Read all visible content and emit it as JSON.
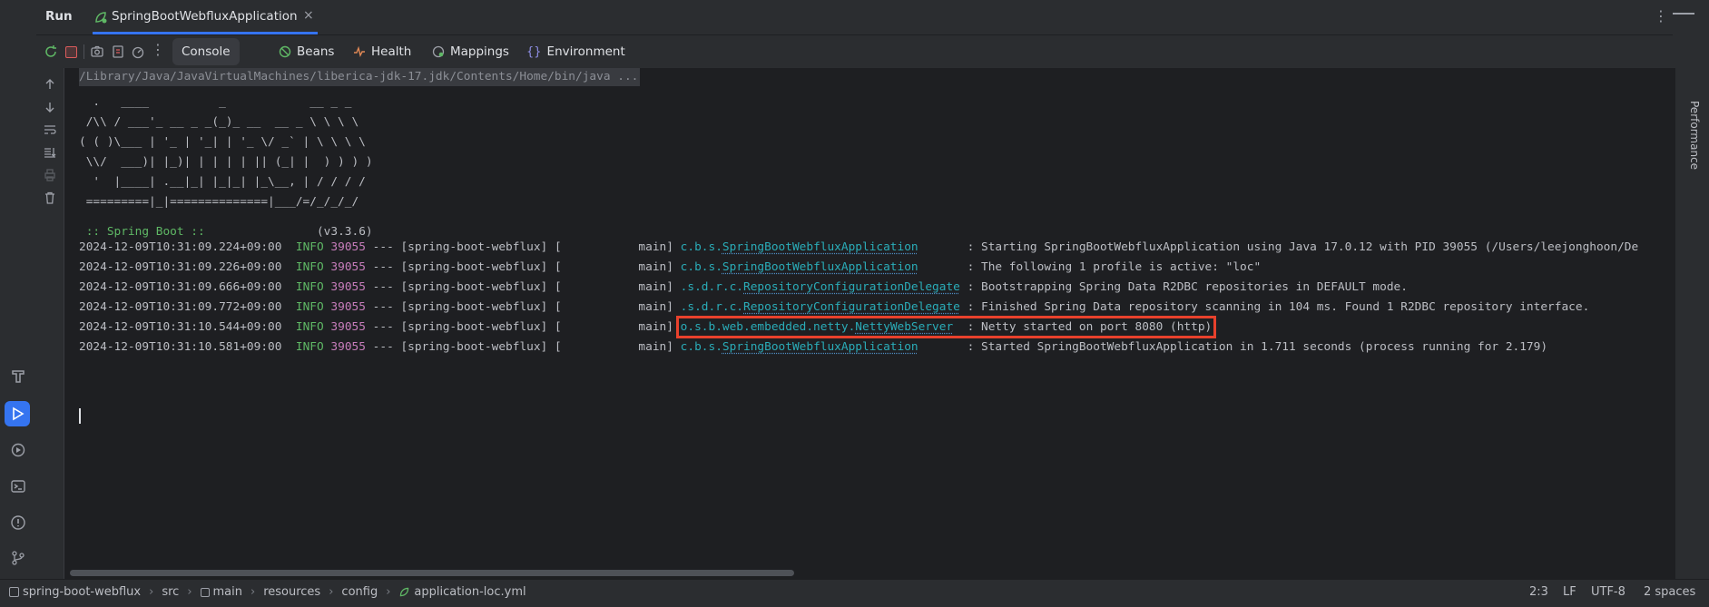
{
  "window": {
    "run_label": "Run",
    "tab_title": "SpringBootWebfluxApplication"
  },
  "toolbar": {
    "tabs": [
      {
        "label": "Console",
        "icon": "console"
      },
      {
        "label": "Beans",
        "icon": "beans-icon"
      },
      {
        "label": "Health",
        "icon": "health-icon"
      },
      {
        "label": "Mappings",
        "icon": "mappings-icon"
      },
      {
        "label": "Environment",
        "icon": "environment-icon"
      }
    ]
  },
  "console": {
    "command": "/Library/Java/JavaVirtualMachines/liberica-jdk-17.jdk/Contents/Home/bin/java ...",
    "banner": [
      "  .   ____          _            __ _ _",
      " /\\\\ / ___'_ __ _ _(_)_ __  __ _ \\ \\ \\ \\",
      "( ( )\\___ | '_ | '_| | '_ \\/ _` | \\ \\ \\ \\",
      " \\\\/  ___)| |_)| | | | | || (_| |  ) ) ) )",
      "  '  |____| .__|_| |_|_| |_\\__, | / / / /",
      " =========|_|==============|___/=/_/_/_/"
    ],
    "spring_boot_label": " :: Spring Boot ::",
    "spring_boot_version": "(v3.3.6)",
    "logs": [
      {
        "ts": "2024-12-09T10:31:09.224+09:00",
        "level": "INFO",
        "pid": "39055",
        "mid": "--- [spring-boot-webflux] [           main]",
        "pkg": "c.b.s.",
        "cls": "SpringBootWebfluxApplication",
        "pad": "       ",
        "msg": ": Starting SpringBootWebfluxApplication using Java 17.0.12 with PID 39055 (/Users/leejonghoon/De"
      },
      {
        "ts": "2024-12-09T10:31:09.226+09:00",
        "level": "INFO",
        "pid": "39055",
        "mid": "--- [spring-boot-webflux] [           main]",
        "pkg": "c.b.s.",
        "cls": "SpringBootWebfluxApplication",
        "pad": "       ",
        "msg": ": The following 1 profile is active: \"loc\""
      },
      {
        "ts": "2024-12-09T10:31:09.666+09:00",
        "level": "INFO",
        "pid": "39055",
        "mid": "--- [spring-boot-webflux] [           main]",
        "pkg": ".s.d.r.c.",
        "cls": "RepositoryConfigurationDelegate",
        "pad": " ",
        "msg": ": Bootstrapping Spring Data R2DBC repositories in DEFAULT mode."
      },
      {
        "ts": "2024-12-09T10:31:09.772+09:00",
        "level": "INFO",
        "pid": "39055",
        "mid": "--- [spring-boot-webflux] [           main]",
        "pkg": ".s.d.r.c.",
        "cls": "RepositoryConfigurationDelegate",
        "pad": " ",
        "msg": ": Finished Spring Data repository scanning in 104 ms. Found 1 R2DBC repository interface."
      },
      {
        "ts": "2024-12-09T10:31:10.544+09:00",
        "level": "INFO",
        "pid": "39055",
        "mid": "--- [spring-boot-webflux] [           main]",
        "pkg": "o.s.b.web.embedded.netty.",
        "cls": "NettyWebServer",
        "pad": "  ",
        "msg": ": Netty started on port 8080 (http)"
      },
      {
        "ts": "2024-12-09T10:31:10.581+09:00",
        "level": "INFO",
        "pid": "39055",
        "mid": "--- [spring-boot-webflux] [           main]",
        "pkg": "c.b.s.",
        "cls": "SpringBootWebfluxApplication",
        "pad": "       ",
        "msg": ": Started SpringBootWebfluxApplication in 1.711 seconds (process running for 2.179)"
      }
    ]
  },
  "right_panel": {
    "performance_label": "Performance"
  },
  "breadcrumb": [
    "spring-boot-webflux",
    "src",
    "main",
    "resources",
    "config",
    "application-loc.yml"
  ],
  "status": {
    "position": "2:3",
    "line_sep": "LF",
    "encoding": "UTF-8",
    "indent": "2 spaces"
  },
  "colors": {
    "highlight_box": "#e8412c",
    "info": "#5fb865",
    "pid": "#c77dbb",
    "logger": "#2aacb8",
    "accent": "#3574f0"
  }
}
